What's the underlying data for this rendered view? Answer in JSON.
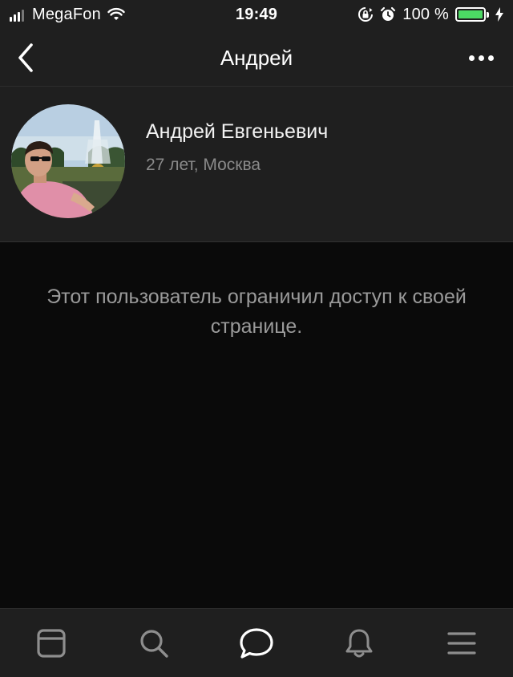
{
  "status_bar": {
    "carrier": "MegaFon",
    "time": "19:49",
    "battery_text": "100 %",
    "signal_icon": "cellular-signal-icon",
    "wifi_icon": "wifi-icon",
    "rotation_lock_icon": "rotation-lock-icon",
    "alarm_icon": "alarm-icon",
    "battery_icon": "battery-icon",
    "charging_icon": "charging-bolt-icon",
    "battery_color": "#4cd964"
  },
  "nav_bar": {
    "title": "Андрей",
    "back_icon": "chevron-left-icon",
    "more_icon": "more-dots-icon"
  },
  "profile": {
    "name": "Андрей Евгеньевич",
    "subtitle": "27 лет, Москва",
    "avatar": "avatar-photo"
  },
  "main": {
    "restricted_message": "Этот пользователь ограничил доступ к своей странице."
  },
  "tab_bar": {
    "tabs": [
      {
        "icon": "news-feed-icon",
        "active": false
      },
      {
        "icon": "search-icon",
        "active": false
      },
      {
        "icon": "messages-icon",
        "active": true
      },
      {
        "icon": "notifications-bell-icon",
        "active": false
      },
      {
        "icon": "menu-icon",
        "active": false
      }
    ]
  },
  "colors": {
    "background": "#0a0a0a",
    "bar_background": "#1f1f1f",
    "secondary_text": "#8a8a8a",
    "tab_icon": "#8e8e8e",
    "tab_icon_active": "#ffffff"
  }
}
